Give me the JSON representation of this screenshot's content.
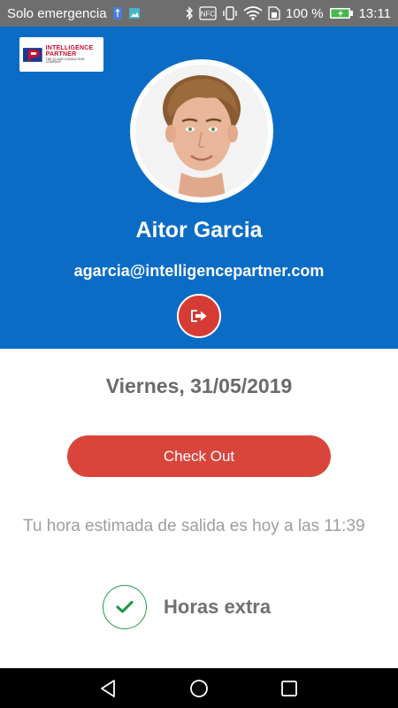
{
  "status_bar": {
    "carrier": "Solo emergencia",
    "battery_percent": "100 %",
    "time": "13:11",
    "icons": [
      "usb-icon",
      "image-icon",
      "bluetooth-icon",
      "nfc-icon",
      "vibrate-icon",
      "wifi-icon",
      "sim-icon",
      "battery-charging-icon"
    ],
    "nfc_label": "NFC"
  },
  "header": {
    "logo": {
      "line1": "INTELLIGENCE",
      "line2": "PARTNER",
      "line3": "THE CLOUD CONSULTING COMPANY"
    },
    "user_name": "Aitor Garcia",
    "user_email": "agarcia@intelligencepartner.com",
    "logout_icon": "sign-out-icon"
  },
  "main": {
    "date": "Viernes, 31/05/2019",
    "checkout_label": "Check Out",
    "estimate_text": "Tu hora estimada de salida es hoy a las 11:39",
    "overtime_label": "Horas extra",
    "overtime_icon": "check-icon"
  },
  "nav": {
    "icons": [
      "back-icon",
      "home-icon",
      "recents-icon"
    ]
  },
  "colors": {
    "header_blue": "#0b6cc6",
    "status_gray": "#6e6e6e",
    "checkout_red": "#d9453b",
    "check_green": "#22994a"
  }
}
